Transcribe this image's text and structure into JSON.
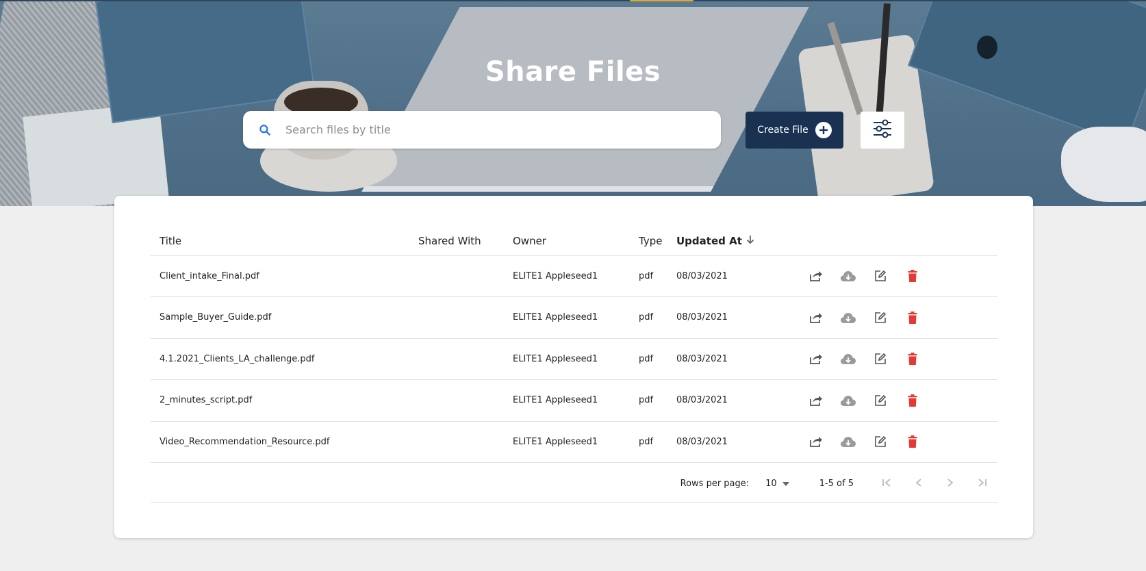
{
  "header": {
    "title": "Share Files",
    "search_placeholder": "Search files by title",
    "create_label": "Create File"
  },
  "colors": {
    "primary": "#1a3152",
    "search_icon": "#1a73e8",
    "delete": "#e53935",
    "accent": "#e0a72a"
  },
  "table": {
    "columns": [
      "Title",
      "Shared With",
      "Owner",
      "Type",
      "Updated At"
    ],
    "sorted_column": "Updated At",
    "sort_direction": "descending",
    "rows": [
      {
        "title": "Client_intake_Final.pdf",
        "shared_with": "",
        "owner": "ELITE1 Appleseed1",
        "type": "pdf",
        "updated": "08/03/2021"
      },
      {
        "title": "Sample_Buyer_Guide.pdf",
        "shared_with": "",
        "owner": "ELITE1 Appleseed1",
        "type": "pdf",
        "updated": "08/03/2021"
      },
      {
        "title": "4.1.2021_Clients_LA_challenge.pdf",
        "shared_with": "",
        "owner": "ELITE1 Appleseed1",
        "type": "pdf",
        "updated": "08/03/2021"
      },
      {
        "title": "2_minutes_script.pdf",
        "shared_with": "",
        "owner": "ELITE1 Appleseed1",
        "type": "pdf",
        "updated": "08/03/2021"
      },
      {
        "title": "Video_Recommendation_Resource.pdf",
        "shared_with": "",
        "owner": "ELITE1 Appleseed1",
        "type": "pdf",
        "updated": "08/03/2021"
      }
    ],
    "row_actions": [
      "share-icon",
      "cloud-download-icon",
      "edit-icon",
      "delete-icon"
    ]
  },
  "pagination": {
    "rows_per_page_label": "Rows per page:",
    "rows_per_page": "10",
    "range": "1-5 of 5"
  }
}
